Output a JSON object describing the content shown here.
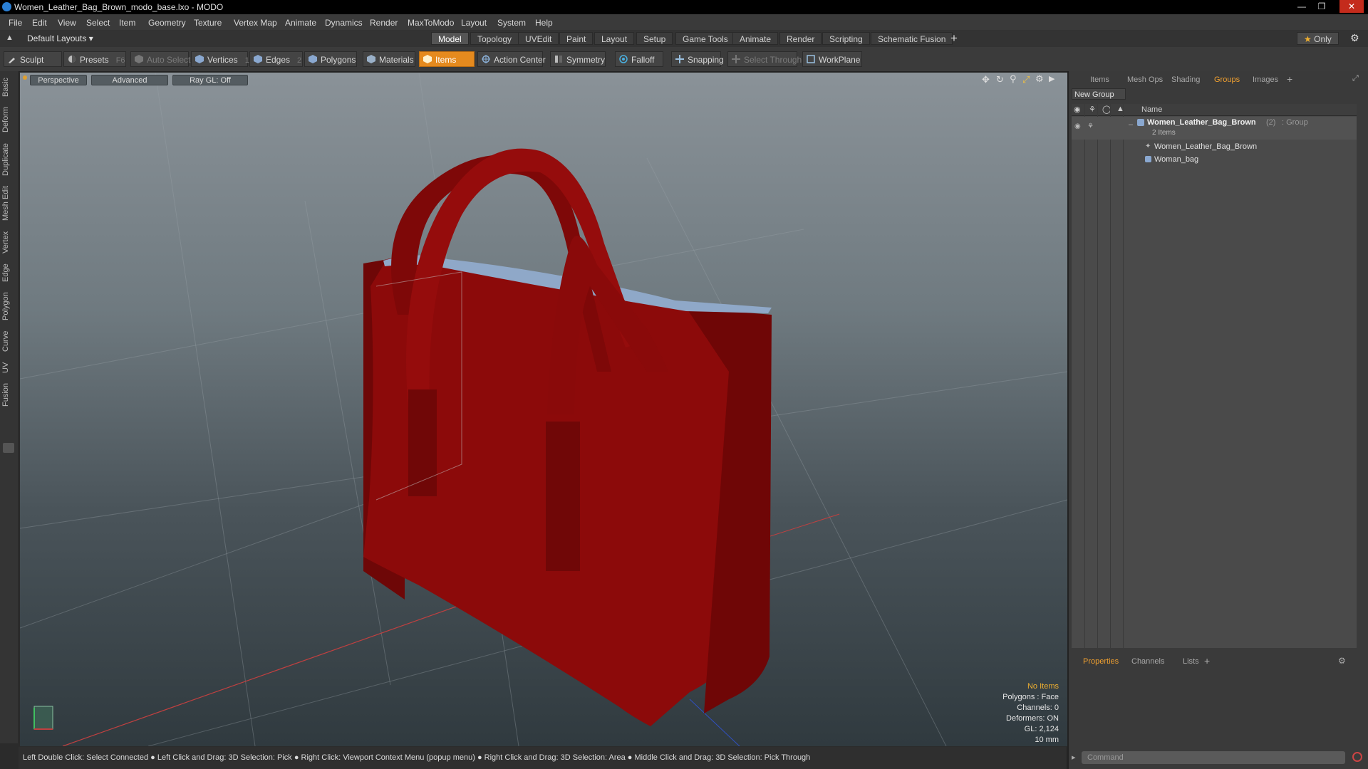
{
  "window": {
    "title": "Women_Leather_Bag_Brown_modo_base.lxo - MODO"
  },
  "menu": [
    "File",
    "Edit",
    "View",
    "Select",
    "Item",
    "Geometry",
    "Texture",
    "Vertex Map",
    "Animate",
    "Dynamics",
    "Render",
    "MaxToModo",
    "Layout",
    "System",
    "Help"
  ],
  "layout_selector": "Default Layouts",
  "layout_tabs": [
    "Model",
    "Topology",
    "UVEdit",
    "Paint",
    "Layout",
    "Setup",
    "Game Tools",
    "Animate",
    "Render",
    "Scripting",
    "Schematic Fusion"
  ],
  "active_layout_tab": "Model",
  "only_label": "Only",
  "toolbar": {
    "sculpt": "Sculpt",
    "presets": "Presets",
    "presets_shortcut": "F6",
    "auto_select": "Auto Select",
    "vertices": "Vertices",
    "vertices_count": "1",
    "edges": "Edges",
    "edges_count": "2",
    "polygons": "Polygons",
    "materials": "Materials",
    "items": "Items",
    "action_center": "Action Center",
    "symmetry": "Symmetry",
    "falloff": "Falloff",
    "snapping": "Snapping",
    "select_through": "Select Through",
    "workplane": "WorkPlane"
  },
  "left_tabs": [
    "Basic",
    "Deform",
    "Duplicate",
    "Mesh Edit",
    "Vertex",
    "Edge",
    "Polygon",
    "Curve",
    "UV",
    "Fusion"
  ],
  "viewport": {
    "view_mode": "Perspective",
    "shading": "Advanced",
    "raygl": "Ray GL: Off",
    "hud": {
      "selection": "No Items",
      "polygons": "Polygons : Face",
      "channels": "Channels: 0",
      "deformers": "Deformers: ON",
      "gl": "GL: 2,124",
      "scale": "10 mm"
    }
  },
  "status_bar": "Left Double Click: Select Connected ● Left Click and Drag: 3D Selection: Pick ● Right Click: Viewport Context Menu (popup menu) ● Right Click and Drag: 3D Selection: Area ● Middle Click and Drag: 3D Selection: Pick Through",
  "right_panel": {
    "tabs": [
      "Items",
      "Mesh Ops",
      "Shading",
      "Groups",
      "Images"
    ],
    "active_tab": "Groups",
    "new_group": "New Group",
    "name_header": "Name",
    "group": {
      "name": "Women_Leather_Bag_Brown",
      "count": "(2)",
      "type": ": Group",
      "sub": "2 Items"
    },
    "children": [
      "Women_Leather_Bag_Brown",
      "Woman_bag"
    ],
    "bottom_tabs": [
      "Properties",
      "Channels",
      "Lists"
    ],
    "active_bottom_tab": "Properties",
    "command_placeholder": "Command"
  },
  "colors": {
    "accent": "#e58a1e",
    "bag": "#8c0a0a",
    "active_tab_text": "#f0a030"
  }
}
